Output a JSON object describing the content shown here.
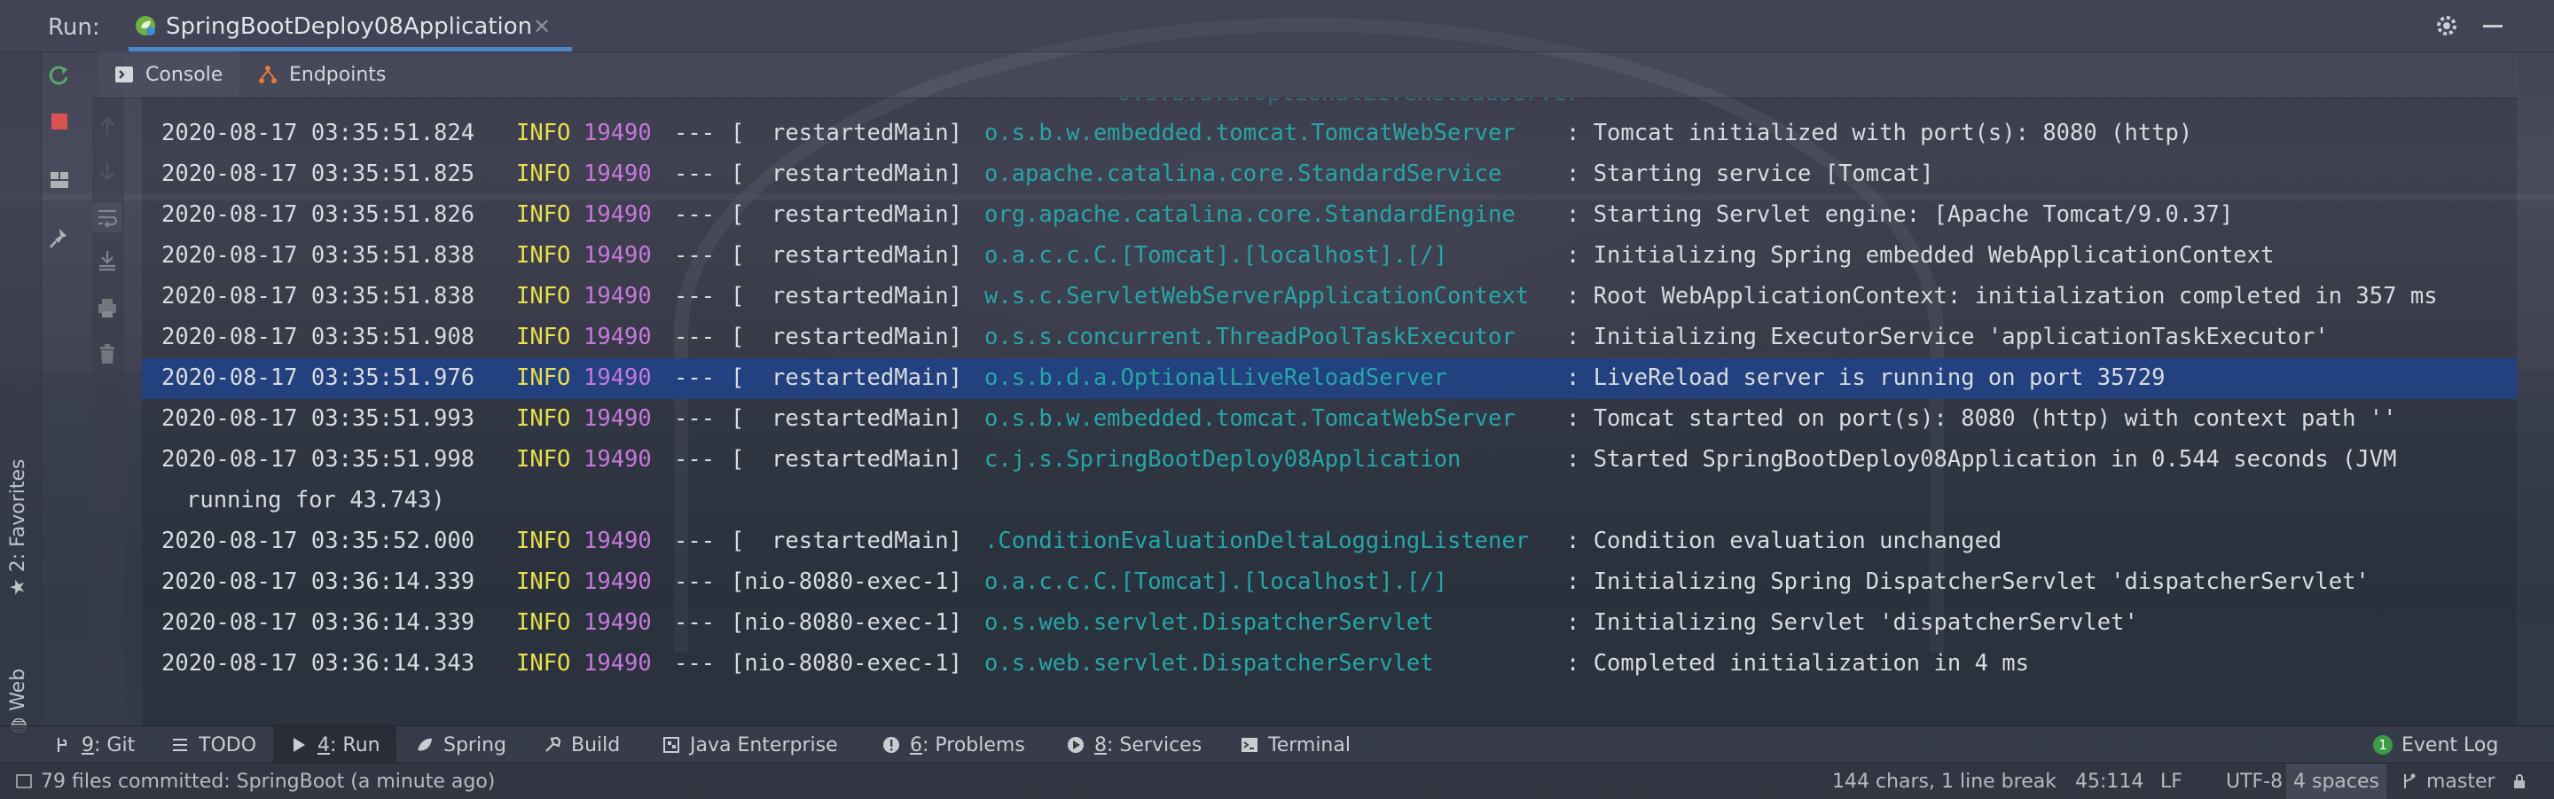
{
  "header": {
    "run_label": "Run:",
    "tab_title": "SpringBootDeploy08Application"
  },
  "left_strip": {
    "favorites_label": "2: Favorites",
    "web_label": "Web"
  },
  "sub_tabs": [
    {
      "label": "Console",
      "icon": "console-icon"
    },
    {
      "label": "Endpoints",
      "icon": "endpoints-icon"
    }
  ],
  "console": {
    "top_fragment": "o.s.b.d.a.OptionalLiveReloadServer",
    "lines": [
      {
        "ts": "2020-08-17 03:35:51.824",
        "level": "INFO",
        "pid": "19490",
        "sep": "---",
        "thread": "[  restartedMain]",
        "logger": "o.s.b.w.embedded.tomcat.TomcatWebServer",
        "msg": ": Tomcat initialized with port(s): 8080 (http)"
      },
      {
        "ts": "2020-08-17 03:35:51.825",
        "level": "INFO",
        "pid": "19490",
        "sep": "---",
        "thread": "[  restartedMain]",
        "logger": "o.apache.catalina.core.StandardService",
        "msg": ": Starting service [Tomcat]"
      },
      {
        "ts": "2020-08-17 03:35:51.826",
        "level": "INFO",
        "pid": "19490",
        "sep": "---",
        "thread": "[  restartedMain]",
        "logger": "org.apache.catalina.core.StandardEngine",
        "msg": ": Starting Servlet engine: [Apache Tomcat/9.0.37]"
      },
      {
        "ts": "2020-08-17 03:35:51.838",
        "level": "INFO",
        "pid": "19490",
        "sep": "---",
        "thread": "[  restartedMain]",
        "logger": "o.a.c.c.C.[Tomcat].[localhost].[/]",
        "msg": ": Initializing Spring embedded WebApplicationContext"
      },
      {
        "ts": "2020-08-17 03:35:51.838",
        "level": "INFO",
        "pid": "19490",
        "sep": "---",
        "thread": "[  restartedMain]",
        "logger": "w.s.c.ServletWebServerApplicationContext",
        "msg": ": Root WebApplicationContext: initialization completed in 357 ms"
      },
      {
        "ts": "2020-08-17 03:35:51.908",
        "level": "INFO",
        "pid": "19490",
        "sep": "---",
        "thread": "[  restartedMain]",
        "logger": "o.s.s.concurrent.ThreadPoolTaskExecutor",
        "msg": ": Initializing ExecutorService 'applicationTaskExecutor'"
      },
      {
        "ts": "2020-08-17 03:35:51.976",
        "level": "INFO",
        "pid": "19490",
        "sep": "---",
        "thread": "[  restartedMain]",
        "logger": "o.s.b.d.a.OptionalLiveReloadServer",
        "msg": ": LiveReload server is running on port 35729",
        "selected": true
      },
      {
        "ts": "2020-08-17 03:35:51.993",
        "level": "INFO",
        "pid": "19490",
        "sep": "---",
        "thread": "[  restartedMain]",
        "logger": "o.s.b.w.embedded.tomcat.TomcatWebServer",
        "msg": ": Tomcat started on port(s): 8080 (http) with context path ''"
      },
      {
        "ts": "2020-08-17 03:35:51.998",
        "level": "INFO",
        "pid": "19490",
        "sep": "---",
        "thread": "[  restartedMain]",
        "logger": "c.j.s.SpringBootDeploy08Application",
        "msg": ": Started SpringBootDeploy08Application in 0.544 seconds (JVM",
        "cont": "running for 43.743)"
      },
      {
        "ts": "2020-08-17 03:35:52.000",
        "level": "INFO",
        "pid": "19490",
        "sep": "---",
        "thread": "[  restartedMain]",
        "logger": ".ConditionEvaluationDeltaLoggingListener",
        "msg": ": Condition evaluation unchanged"
      },
      {
        "ts": "2020-08-17 03:36:14.339",
        "level": "INFO",
        "pid": "19490",
        "sep": "---",
        "thread": "[nio-8080-exec-1]",
        "logger": "o.a.c.c.C.[Tomcat].[localhost].[/]",
        "msg": ": Initializing Spring DispatcherServlet 'dispatcherServlet'"
      },
      {
        "ts": "2020-08-17 03:36:14.339",
        "level": "INFO",
        "pid": "19490",
        "sep": "---",
        "thread": "[nio-8080-exec-1]",
        "logger": "o.s.web.servlet.DispatcherServlet",
        "msg": ": Initializing Servlet 'dispatcherServlet'"
      },
      {
        "ts": "2020-08-17 03:36:14.343",
        "level": "INFO",
        "pid": "19490",
        "sep": "---",
        "thread": "[nio-8080-exec-1]",
        "logger": "o.s.web.servlet.DispatcherServlet",
        "msg": ": Completed initialization in 4 ms"
      }
    ]
  },
  "tool_windows": [
    {
      "key": "9",
      "rest": ": Git",
      "icon": "git-icon"
    },
    {
      "key": "",
      "rest": "TODO",
      "icon": "todo-icon"
    },
    {
      "key": "4",
      "rest": ": Run",
      "icon": "run-icon",
      "active": true
    },
    {
      "key": "",
      "rest": "Spring",
      "icon": "spring-icon"
    },
    {
      "key": "",
      "rest": "Build",
      "icon": "build-icon"
    },
    {
      "key": "",
      "rest": "Java Enterprise",
      "icon": "java-enterprise-icon"
    },
    {
      "key": "6",
      "rest": ": Problems",
      "icon": "problems-icon"
    },
    {
      "key": "8",
      "rest": ": Services",
      "icon": "services-icon"
    },
    {
      "key": "",
      "rest": "Terminal",
      "icon": "terminal-icon"
    }
  ],
  "event_log": {
    "count": "1",
    "label": "Event Log"
  },
  "status": {
    "message": "79 files committed: SpringBoot (a minute ago)",
    "chars": "144 chars, 1 line break",
    "position": "45:114",
    "line_sep": "LF",
    "encoding": "UTF-8",
    "indent": "4 spaces",
    "branch": "master"
  },
  "colors": {
    "accent": "#4a88c7",
    "selection": "#214283",
    "info": "#e8e04c",
    "pid": "#c678dd",
    "logger": "#26a6a6",
    "event_badge": "#3d9a47"
  }
}
